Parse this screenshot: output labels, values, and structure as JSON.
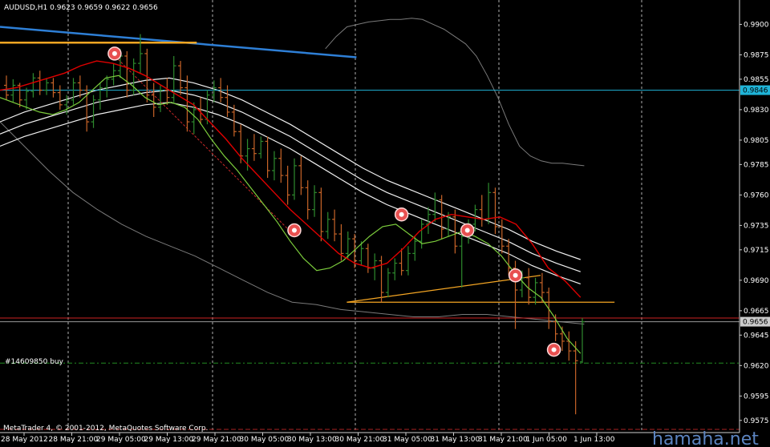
{
  "header": {
    "symbol": "AUDUSD,H1",
    "ohlc": "0.9623 0.9659 0.9622 0.9656"
  },
  "order_label": "#14609850 buy",
  "copyright": "MetaTrader 4, © 2001-2012, MetaQuotes Software Corp.",
  "watermark": "hamaha.net",
  "colors": {
    "background": "#000000",
    "candle_up": "#2e8b2e",
    "candle_down": "#c86428",
    "fast_ma": "#e00000",
    "mid_ma": "#7ccd3c",
    "envelope": "#f0f0f0",
    "bands": "#7a7a7a",
    "trend_blue": "#2e7fd6",
    "orange": "#f5a623",
    "price_line": "#cc2222",
    "order_line": "#228b22",
    "cyan_level": "#1fb4d8"
  },
  "chart_data": {
    "type": "candlestick",
    "ylim": [
      0.9565,
      0.992
    ],
    "y_ticks": [
      "0.9900",
      "0.9875",
      "0.9855",
      "0.9830",
      "0.9805",
      "0.9785",
      "0.9760",
      "0.9735",
      "0.9715",
      "0.9690",
      "0.9665",
      "0.9645",
      "0.9620",
      "0.9595",
      "0.9575"
    ],
    "x_ticks": [
      "28 May 2012",
      "28 May 21:00",
      "29 May 05:00",
      "29 May 13:00",
      "29 May 21:00",
      "30 May 05:00",
      "30 May 13:00",
      "30 May 21:00",
      "31 May 05:00",
      "31 May 13:00",
      "31 May 21:00",
      "1 Jun 05:00",
      "1 Jun 13:00"
    ],
    "tagged_levels": [
      {
        "label": "0.9846",
        "value": 0.9846,
        "color": "#1fb4d8"
      },
      {
        "label": "0.9656",
        "value": 0.9656,
        "color": "#cccccc"
      }
    ],
    "levels": [
      {
        "name": "cyan-level",
        "value": 0.9846
      },
      {
        "name": "red-price-line",
        "value": 0.9659
      },
      {
        "name": "grey-bid-line",
        "value": 0.9656
      },
      {
        "name": "order-line",
        "value": 0.9622
      }
    ],
    "candles": [
      [
        0.985,
        0.9858,
        0.9838,
        0.9842
      ],
      [
        0.9842,
        0.9855,
        0.9836,
        0.985
      ],
      [
        0.985,
        0.9852,
        0.9832,
        0.9838
      ],
      [
        0.9838,
        0.9848,
        0.983,
        0.9845
      ],
      [
        0.9845,
        0.986,
        0.984,
        0.9856
      ],
      [
        0.9856,
        0.9862,
        0.9842,
        0.9846
      ],
      [
        0.9846,
        0.9856,
        0.9842,
        0.9852
      ],
      [
        0.9852,
        0.9856,
        0.984,
        0.9844
      ],
      [
        0.9844,
        0.985,
        0.983,
        0.9834
      ],
      [
        0.9834,
        0.9842,
        0.9826,
        0.9838
      ],
      [
        0.9838,
        0.9856,
        0.9834,
        0.9852
      ],
      [
        0.9852,
        0.9858,
        0.984,
        0.9846
      ],
      [
        0.9846,
        0.985,
        0.9812,
        0.982
      ],
      [
        0.982,
        0.9842,
        0.9815,
        0.9838
      ],
      [
        0.9838,
        0.9852,
        0.983,
        0.9848
      ],
      [
        0.9848,
        0.9858,
        0.984,
        0.9855
      ],
      [
        0.9855,
        0.9868,
        0.985,
        0.9862
      ],
      [
        0.9862,
        0.988,
        0.9856,
        0.9874
      ],
      [
        0.9874,
        0.9878,
        0.984,
        0.9846
      ],
      [
        0.9846,
        0.9872,
        0.9842,
        0.9868
      ],
      [
        0.9868,
        0.9892,
        0.986,
        0.9876
      ],
      [
        0.9876,
        0.988,
        0.9836,
        0.9842
      ],
      [
        0.9842,
        0.9852,
        0.9824,
        0.9832
      ],
      [
        0.9832,
        0.985,
        0.9828,
        0.9846
      ],
      [
        0.9846,
        0.9856,
        0.9834,
        0.984
      ],
      [
        0.984,
        0.9874,
        0.9836,
        0.9866
      ],
      [
        0.9866,
        0.987,
        0.9842,
        0.9848
      ],
      [
        0.9848,
        0.9858,
        0.9812,
        0.982
      ],
      [
        0.982,
        0.9836,
        0.981,
        0.983
      ],
      [
        0.983,
        0.984,
        0.9818,
        0.9822
      ],
      [
        0.9822,
        0.9846,
        0.9818,
        0.9842
      ],
      [
        0.9842,
        0.9854,
        0.9836,
        0.9848
      ],
      [
        0.9848,
        0.9856,
        0.9836,
        0.984
      ],
      [
        0.984,
        0.985,
        0.9824,
        0.9828
      ],
      [
        0.9828,
        0.9834,
        0.9808,
        0.9812
      ],
      [
        0.9812,
        0.9818,
        0.9786,
        0.9792
      ],
      [
        0.9792,
        0.9806,
        0.978,
        0.9798
      ],
      [
        0.9798,
        0.981,
        0.9788,
        0.9794
      ],
      [
        0.9794,
        0.9808,
        0.979,
        0.9804
      ],
      [
        0.9804,
        0.9808,
        0.9774,
        0.978
      ],
      [
        0.978,
        0.9796,
        0.9772,
        0.979
      ],
      [
        0.979,
        0.9798,
        0.977,
        0.9776
      ],
      [
        0.9776,
        0.9784,
        0.9752,
        0.976
      ],
      [
        0.976,
        0.979,
        0.9756,
        0.9784
      ],
      [
        0.9784,
        0.9792,
        0.976,
        0.9766
      ],
      [
        0.9766,
        0.9772,
        0.974,
        0.9748
      ],
      [
        0.9748,
        0.9768,
        0.9742,
        0.9762
      ],
      [
        0.9762,
        0.9766,
        0.9722,
        0.973
      ],
      [
        0.973,
        0.9746,
        0.9724,
        0.974
      ],
      [
        0.974,
        0.9748,
        0.9722,
        0.9728
      ],
      [
        0.9728,
        0.9736,
        0.9706,
        0.9712
      ],
      [
        0.9712,
        0.973,
        0.9708,
        0.9724
      ],
      [
        0.9724,
        0.9728,
        0.97,
        0.9706
      ],
      [
        0.9706,
        0.9722,
        0.9702,
        0.9716
      ],
      [
        0.9716,
        0.972,
        0.9696,
        0.97
      ],
      [
        0.97,
        0.9712,
        0.969,
        0.9706
      ],
      [
        0.9706,
        0.971,
        0.9672,
        0.968
      ],
      [
        0.968,
        0.97,
        0.9676,
        0.9696
      ],
      [
        0.9696,
        0.9708,
        0.969,
        0.9704
      ],
      [
        0.9704,
        0.9716,
        0.9694,
        0.9698
      ],
      [
        0.9698,
        0.9718,
        0.9694,
        0.9712
      ],
      [
        0.9712,
        0.9726,
        0.9706,
        0.9722
      ],
      [
        0.9722,
        0.974,
        0.9716,
        0.9736
      ],
      [
        0.9736,
        0.975,
        0.9728,
        0.9744
      ],
      [
        0.9744,
        0.9762,
        0.9738,
        0.9756
      ],
      [
        0.9756,
        0.976,
        0.9724,
        0.9732
      ],
      [
        0.9732,
        0.9746,
        0.9726,
        0.9742
      ],
      [
        0.9742,
        0.9748,
        0.9712,
        0.9718
      ],
      [
        0.9718,
        0.973,
        0.9684,
        0.9726
      ],
      [
        0.9726,
        0.974,
        0.972,
        0.9736
      ],
      [
        0.9736,
        0.9752,
        0.973,
        0.9748
      ],
      [
        0.9748,
        0.976,
        0.9734,
        0.974
      ],
      [
        0.974,
        0.977,
        0.9736,
        0.9762
      ],
      [
        0.9762,
        0.9766,
        0.9728,
        0.9734
      ],
      [
        0.9734,
        0.974,
        0.9712,
        0.9718
      ],
      [
        0.9718,
        0.9724,
        0.9694,
        0.97
      ],
      [
        0.97,
        0.9706,
        0.965,
        0.9682
      ],
      [
        0.9682,
        0.9698,
        0.9676,
        0.9692
      ],
      [
        0.9692,
        0.97,
        0.967,
        0.9676
      ],
      [
        0.9676,
        0.9692,
        0.967,
        0.9688
      ],
      [
        0.9688,
        0.9696,
        0.9672,
        0.968
      ],
      [
        0.968,
        0.9684,
        0.965,
        0.9656
      ],
      [
        0.9656,
        0.9662,
        0.964,
        0.9646
      ],
      [
        0.9646,
        0.9652,
        0.9632,
        0.964
      ],
      [
        0.964,
        0.9648,
        0.9624,
        0.9632
      ],
      [
        0.9632,
        0.964,
        0.958,
        0.9624
      ],
      [
        0.9623,
        0.9659,
        0.9622,
        0.9656
      ]
    ],
    "fast_ma": [
      0.9846,
      0.9848,
      0.9852,
      0.9856,
      0.986,
      0.9866,
      0.987,
      0.9868,
      0.9864,
      0.9858,
      0.985,
      0.9842,
      0.9834,
      0.982,
      0.9806,
      0.979,
      0.9776,
      0.9762,
      0.9748,
      0.9736,
      0.9724,
      0.9712,
      0.9704,
      0.97,
      0.9704,
      0.9716,
      0.973,
      0.974,
      0.9744,
      0.9742,
      0.974,
      0.9742,
      0.9736,
      0.972,
      0.97,
      0.969,
      0.9676
    ],
    "mid_ma": [
      0.984,
      0.9836,
      0.9832,
      0.9828,
      0.9826,
      0.983,
      0.9836,
      0.9846,
      0.9856,
      0.9858,
      0.985,
      0.984,
      0.9834,
      0.9836,
      0.9832,
      0.9822,
      0.9806,
      0.9792,
      0.978,
      0.9766,
      0.9752,
      0.9738,
      0.9722,
      0.9708,
      0.9698,
      0.97,
      0.9706,
      0.9716,
      0.9726,
      0.9734,
      0.9736,
      0.9728,
      0.972,
      0.9722,
      0.9726,
      0.973,
      0.9726,
      0.972,
      0.971,
      0.9696,
      0.9684,
      0.9676,
      0.966,
      0.9642,
      0.963
    ],
    "envelope": [
      [
        0.982,
        0.9828,
        0.9834,
        0.984,
        0.9846,
        0.985,
        0.9854,
        0.9856,
        0.9852,
        0.9846,
        0.9838,
        0.9828,
        0.9818,
        0.9806,
        0.9794,
        0.9782,
        0.9772,
        0.9764,
        0.9756,
        0.9748,
        0.974,
        0.9732,
        0.9722,
        0.9714,
        0.9707
      ],
      [
        0.981,
        0.9818,
        0.9824,
        0.983,
        0.9836,
        0.984,
        0.9844,
        0.9846,
        0.9842,
        0.9836,
        0.9828,
        0.9818,
        0.9808,
        0.9796,
        0.9784,
        0.9772,
        0.9762,
        0.9754,
        0.9746,
        0.9738,
        0.973,
        0.9722,
        0.9712,
        0.9704,
        0.9697
      ],
      [
        0.98,
        0.9808,
        0.9814,
        0.982,
        0.9826,
        0.983,
        0.9834,
        0.9836,
        0.9832,
        0.9826,
        0.9818,
        0.9808,
        0.9798,
        0.9786,
        0.9774,
        0.9762,
        0.9752,
        0.9744,
        0.9736,
        0.9728,
        0.972,
        0.9712,
        0.9702,
        0.9694,
        0.9687
      ]
    ],
    "bands_upper": [
      0.988,
      0.989,
      0.9898,
      0.99,
      0.9902,
      0.9903,
      0.9904,
      0.9904,
      0.9905,
      0.9904,
      0.99,
      0.9896,
      0.989,
      0.9884,
      0.9874,
      0.9858,
      0.984,
      0.9818,
      0.98,
      0.9792,
      0.9788,
      0.9786,
      0.9786,
      0.9785,
      0.9784
    ],
    "bands_lower": [
      0.982,
      0.98,
      0.978,
      0.9762,
      0.9748,
      0.9736,
      0.9726,
      0.9718,
      0.971,
      0.97,
      0.969,
      0.968,
      0.9672,
      0.967,
      0.9666,
      0.9664,
      0.9662,
      0.966,
      0.966,
      0.9662,
      0.9662,
      0.966,
      0.9658,
      0.9656,
      0.9654
    ],
    "trend_lines": [
      {
        "name": "blue-downtrend",
        "from": [
          0,
          0.9898
        ],
        "to": [
          0.482,
          0.9873
        ]
      },
      {
        "name": "orange-top",
        "from": [
          0,
          0.9885
        ],
        "to": [
          0.266,
          0.9885
        ]
      },
      {
        "name": "orange-support",
        "from": [
          0.469,
          0.9672
        ],
        "to": [
          0.731,
          0.9694
        ]
      },
      {
        "name": "orange-horizontal",
        "from": [
          0.469,
          0.9672
        ],
        "to": [
          0.831,
          0.9672
        ]
      },
      {
        "name": "red-dashed-diagonal",
        "from": [
          0.152,
          0.9876
        ],
        "to": [
          0.396,
          0.9728
        ]
      }
    ],
    "markers": [
      {
        "type": "sell",
        "x": 0.155,
        "value": 0.9876
      },
      {
        "type": "buy",
        "x": 0.398,
        "value": 0.9731
      },
      {
        "type": "sell",
        "x": 0.543,
        "value": 0.9744
      },
      {
        "type": "buy",
        "x": 0.632,
        "value": 0.9731
      },
      {
        "type": "sell",
        "x": 0.697,
        "value": 0.9694
      },
      {
        "type": "buy",
        "x": 0.749,
        "value": 0.9633
      }
    ]
  }
}
